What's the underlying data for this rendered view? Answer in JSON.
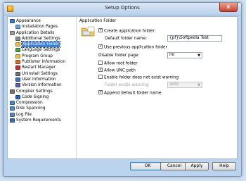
{
  "window": {
    "title": "Setup Options",
    "close_label": "x"
  },
  "tree": [
    {
      "label": "Appearance",
      "level": 0,
      "icon": "appearance-icon",
      "color": "#3a78c8",
      "selected": false
    },
    {
      "label": "Installation Pages",
      "level": 1,
      "icon": "pages-icon",
      "color": "#6aa0d8",
      "selected": false
    },
    {
      "label": "Application Details",
      "level": 0,
      "icon": "details-icon",
      "color": "#9a9a9a",
      "selected": false
    },
    {
      "label": "Additional Settings",
      "level": 1,
      "icon": "settings-icon",
      "color": "#8a8a8a",
      "selected": false
    },
    {
      "label": "Application Folder",
      "level": 1,
      "icon": "folder-icon",
      "color": "#e8c050",
      "selected": true
    },
    {
      "label": "Language Settings",
      "level": 1,
      "icon": "language-icon",
      "color": "#4aa050",
      "selected": false
    },
    {
      "label": "Program Group",
      "level": 1,
      "icon": "group-icon",
      "color": "#e8c050",
      "selected": false
    },
    {
      "label": "Publisher Information",
      "level": 1,
      "icon": "publisher-icon",
      "color": "#d07030",
      "selected": false
    },
    {
      "label": "Restart Manager",
      "level": 1,
      "icon": "restart-icon",
      "color": "#c03030",
      "selected": false
    },
    {
      "label": "Uninstall Settings",
      "level": 1,
      "icon": "uninstall-icon",
      "color": "#707070",
      "selected": false
    },
    {
      "label": "User Information",
      "level": 1,
      "icon": "user-icon",
      "color": "#4070c0",
      "selected": false
    },
    {
      "label": "Version Information",
      "level": 1,
      "icon": "version-icon",
      "color": "#6060b0",
      "selected": false
    },
    {
      "label": "Compiler Settings",
      "level": 0,
      "icon": "compiler-icon",
      "color": "#707070",
      "selected": false
    },
    {
      "label": "Code Signing",
      "level": 1,
      "icon": "signing-icon",
      "color": "#3060b0",
      "selected": false
    },
    {
      "label": "Compression",
      "level": 0,
      "icon": "compression-icon",
      "color": "#4a8ad0",
      "selected": false
    },
    {
      "label": "Disk Spanning",
      "level": 0,
      "icon": "disk-icon",
      "color": "#4a8ad0",
      "selected": false
    },
    {
      "label": "Log File",
      "level": 0,
      "icon": "log-icon",
      "color": "#5a8ac0",
      "selected": false
    },
    {
      "label": "System Requirements",
      "level": 0,
      "icon": "system-icon",
      "color": "#3a6ab0",
      "selected": false
    }
  ],
  "panel": {
    "section_title": "Application Folder",
    "create_folder": {
      "label": "Create application folder",
      "checked": true
    },
    "default_folder": {
      "label": "Default folder name:",
      "value": "{pf}\\Softpedia Test"
    },
    "use_previous": {
      "label": "Use previous application folder",
      "checked": true
    },
    "disable_page": {
      "label": "Disable folder page:",
      "value": "no"
    },
    "allow_root": {
      "label": "Allow root folder",
      "checked": false
    },
    "allow_unc": {
      "label": "Allow UNC path",
      "checked": true
    },
    "enable_warning": {
      "label": "Enable folder does not exist warning",
      "checked": false
    },
    "folder_exists": {
      "label": "Folder exists warning:",
      "value": "auto"
    },
    "append_default": {
      "label": "Append default folder name",
      "checked": true
    }
  },
  "buttons": {
    "ok": "OK",
    "cancel": "Cancel",
    "apply": "Apply",
    "help": "Help"
  },
  "check_glyph": "✓"
}
